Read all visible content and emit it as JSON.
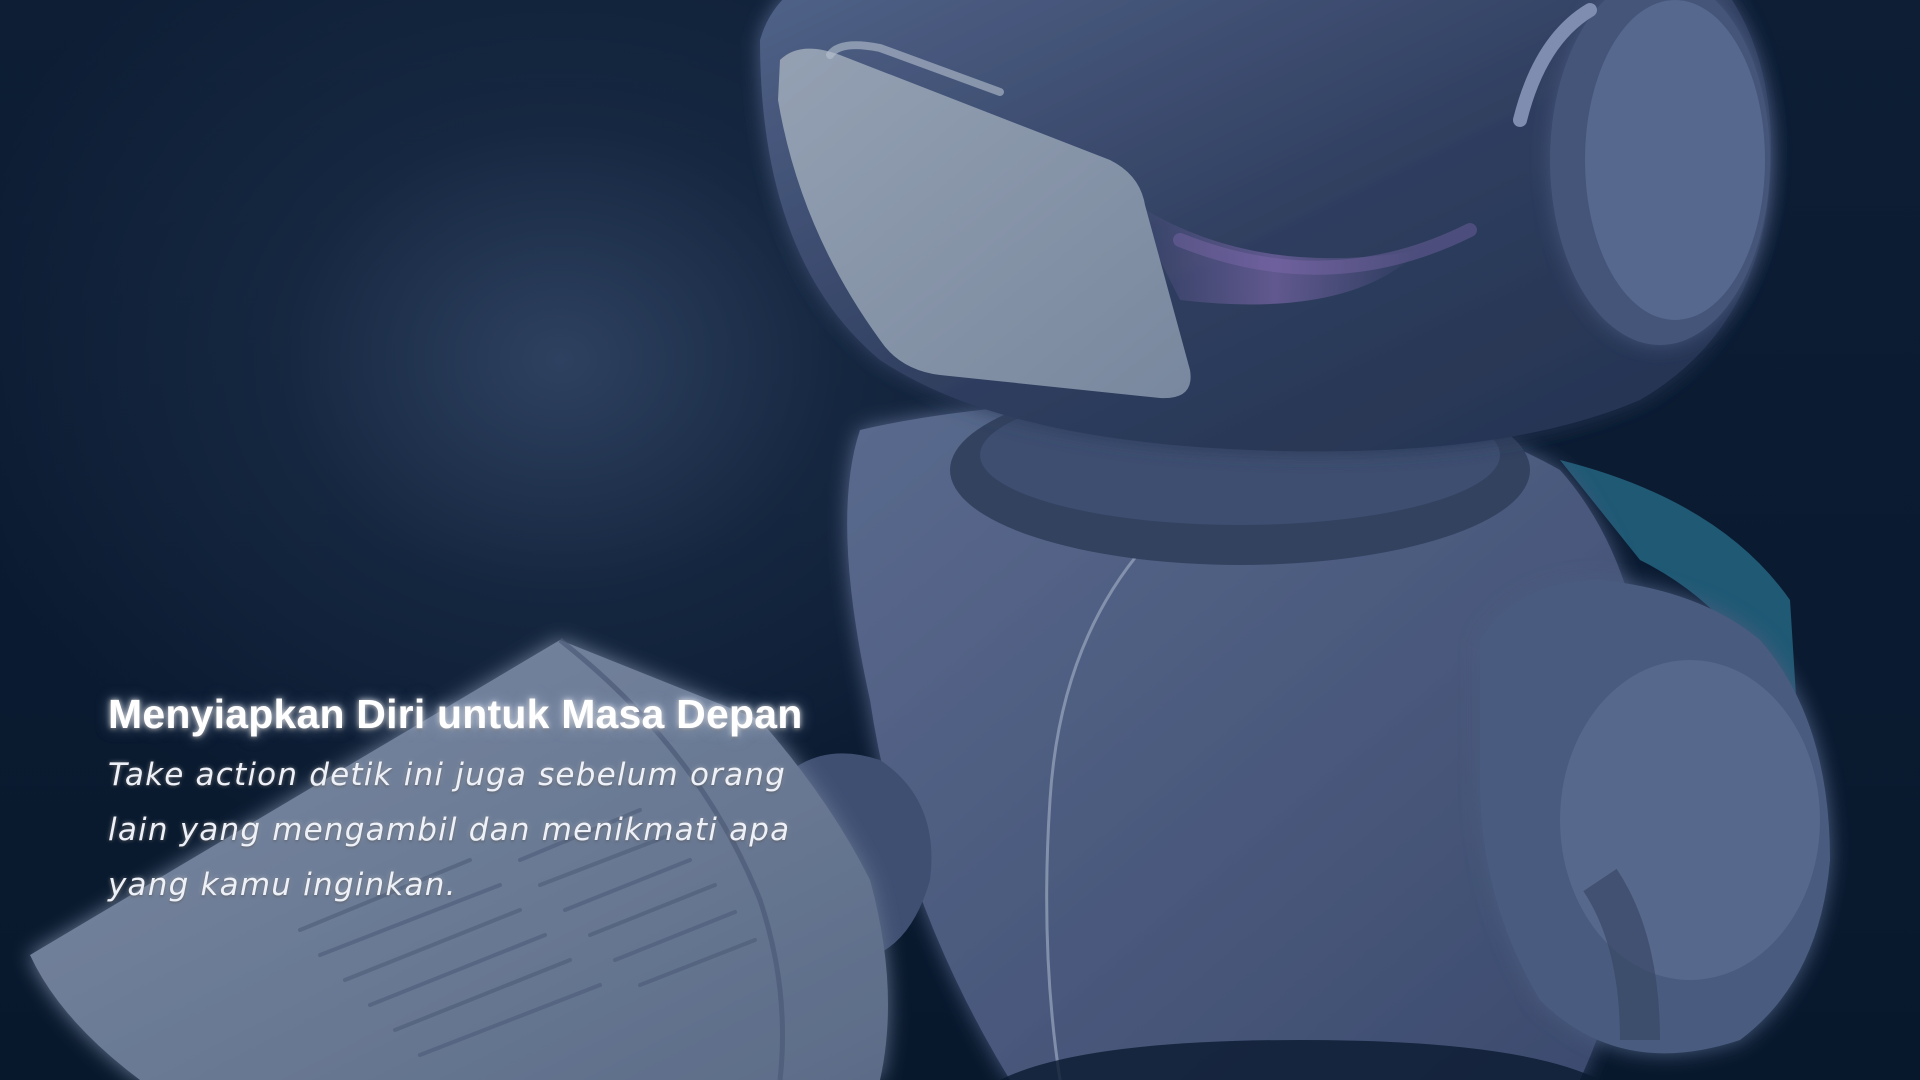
{
  "hero": {
    "title": "Menyiapkan Diri untuk Masa Depan",
    "subtitle": "Take action detik ini juga sebelum orang lain yang mengambil dan menikmati apa yang kamu inginkan."
  },
  "illustration": {
    "subject": "robot-reading-book-illustration",
    "colors": {
      "background": "#0b1a2f",
      "robot_body": "#4b5d80",
      "robot_shadow": "#2b3a59",
      "visor": "#8a98ab",
      "accent_cyan": "#3aa6c8",
      "accent_purple": "#8a6fb8",
      "book_pages": "#6f7f99"
    }
  }
}
